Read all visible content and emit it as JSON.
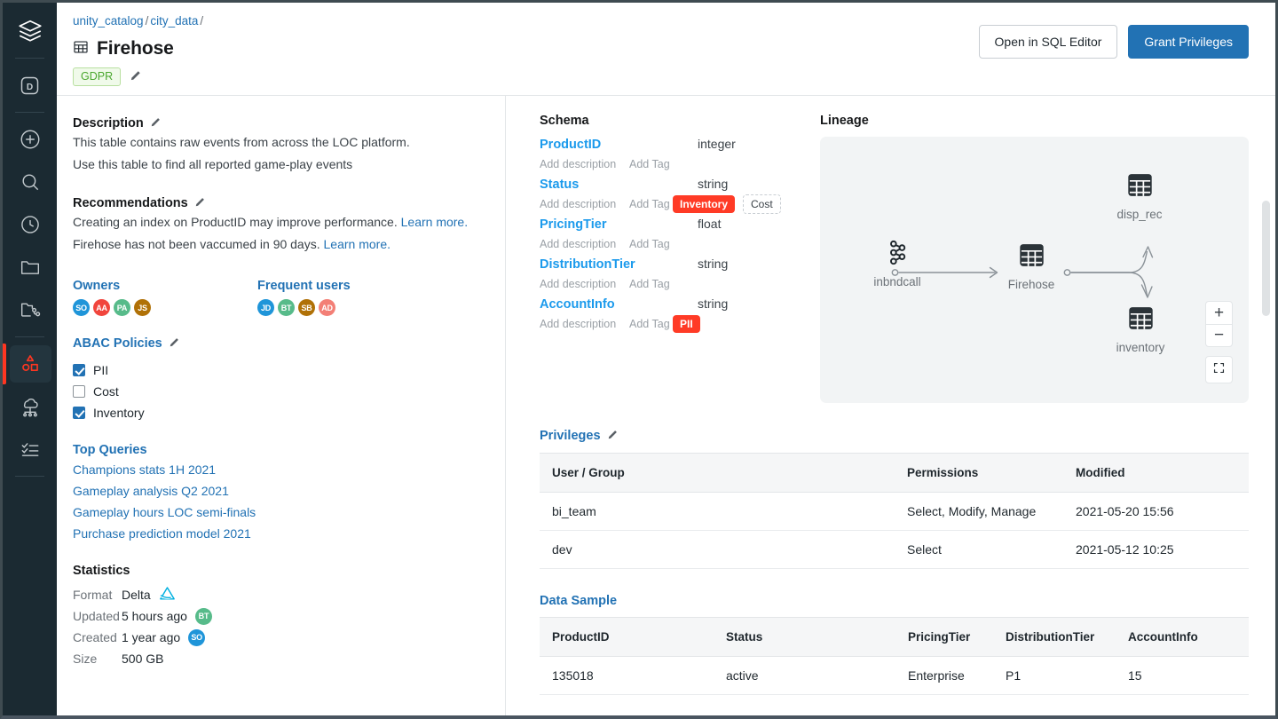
{
  "rail": {
    "items": [
      {
        "name": "logo-layers-icon",
        "label": "Databricks logo"
      },
      {
        "name": "workspace-d-icon",
        "label": "Workspace"
      },
      {
        "name": "plus-circle-icon",
        "label": "New"
      },
      {
        "name": "search-icon",
        "label": "Search"
      },
      {
        "name": "clock-icon",
        "label": "Recents"
      },
      {
        "name": "folder-icon",
        "label": "Workspace files"
      },
      {
        "name": "repos-icon",
        "label": "Repos"
      },
      {
        "name": "data-shapes-icon",
        "label": "Data"
      },
      {
        "name": "compute-icon",
        "label": "Compute"
      },
      {
        "name": "checklist-icon",
        "label": "Jobs"
      }
    ],
    "active_index": 7,
    "accent": "#ff3621",
    "background": "#1b2a32"
  },
  "header": {
    "breadcrumb": [
      {
        "label": "unity_catalog",
        "link": true
      },
      {
        "label": "city_data",
        "link": true
      }
    ],
    "breadcrumb_separator": "/",
    "breadcrumb_trailing": "/",
    "title": "Firehose",
    "title_icon": "table-icon",
    "tag": "GDPR",
    "tag_edit_icon": "pencil-icon",
    "buttons": {
      "secondary": "Open in SQL Editor",
      "primary": "Grant Privileges"
    }
  },
  "left": {
    "description": {
      "heading": "Description",
      "edit_icon": "pencil-icon",
      "lines": [
        "This table contains raw events from across the LOC platform.",
        "Use this table to find all reported game-play events"
      ]
    },
    "recommendations": {
      "heading": "Recommendations",
      "edit_icon": "pencil-icon",
      "items": [
        {
          "text": "Creating an index on ProductID may improve performance.",
          "link": "Learn more."
        },
        {
          "text": "Firehose has not been vaccumed in 90 days.",
          "link": "Learn more."
        }
      ]
    },
    "owners": {
      "heading": "Owners",
      "avatars": [
        {
          "initials": "SO",
          "color": "#1f95d9"
        },
        {
          "initials": "AA",
          "color": "#f1453d"
        },
        {
          "initials": "PA",
          "color": "#57bb8a"
        },
        {
          "initials": "JS",
          "color": "#b07107"
        }
      ]
    },
    "frequent_users": {
      "heading": "Frequent users",
      "avatars": [
        {
          "initials": "JD",
          "color": "#1f95d9"
        },
        {
          "initials": "BT",
          "color": "#57bb8a"
        },
        {
          "initials": "SB",
          "color": "#b07107"
        },
        {
          "initials": "AD",
          "color": "#f37f76"
        }
      ]
    },
    "abac": {
      "heading": "ABAC Policies",
      "edit_icon": "pencil-icon",
      "items": [
        {
          "label": "PII",
          "checked": true
        },
        {
          "label": "Cost",
          "checked": false
        },
        {
          "label": "Inventory",
          "checked": true
        }
      ]
    },
    "top_queries": {
      "heading": "Top Queries",
      "items": [
        "Champions stats 1H 2021",
        "Gameplay analysis Q2 2021",
        "Gameplay hours LOC semi-finals",
        "Purchase prediction model 2021"
      ]
    },
    "statistics": {
      "heading": "Statistics",
      "rows": [
        {
          "label": "Format",
          "value": "Delta",
          "icon": "delta-logo-icon"
        },
        {
          "label": "Updated",
          "value": "5 hours ago",
          "avatar": {
            "initials": "BT",
            "color": "#57bb8a"
          }
        },
        {
          "label": "Created",
          "value": "1 year ago",
          "avatar": {
            "initials": "SO",
            "color": "#1f95d9"
          }
        },
        {
          "label": "Size",
          "value": "500 GB"
        }
      ]
    }
  },
  "schema": {
    "heading": "Schema",
    "add_description_label": "Add description",
    "add_tag_label": "Add Tag",
    "columns": [
      {
        "name": "ProductID",
        "type": "integer",
        "tags": []
      },
      {
        "name": "Status",
        "type": "string",
        "tags": [
          {
            "label": "Inventory",
            "style": "solid"
          },
          {
            "label": "Cost",
            "style": "ghost"
          }
        ]
      },
      {
        "name": "PricingTier",
        "type": "float",
        "tags": []
      },
      {
        "name": "DistributionTier",
        "type": "string",
        "tags": []
      },
      {
        "name": "AccountInfo",
        "type": "string",
        "tags": [
          {
            "label": "PII",
            "style": "solid"
          }
        ]
      }
    ],
    "tag_color": "#ff3b26"
  },
  "lineage": {
    "heading": "Lineage",
    "nodes": [
      {
        "id": "inbndcall",
        "label": "inbndcall",
        "icon": "stream-icon"
      },
      {
        "id": "firehose",
        "label": "Firehose",
        "icon": "table-icon"
      },
      {
        "id": "disp_rec",
        "label": "disp_rec",
        "icon": "table-icon"
      },
      {
        "id": "inventory",
        "label": "inventory",
        "icon": "table-icon"
      }
    ],
    "edges": [
      {
        "from": "inbndcall",
        "to": "firehose"
      },
      {
        "from": "firehose",
        "to": "disp_rec"
      },
      {
        "from": "firehose",
        "to": "inventory"
      }
    ],
    "controls": {
      "zoom_in": "+",
      "zoom_out": "−",
      "fullscreen_icon": "fullscreen-icon"
    }
  },
  "privileges": {
    "heading": "Privileges",
    "edit_icon": "pencil-icon",
    "headers": [
      "User / Group",
      "Permissions",
      "Modified"
    ],
    "rows": [
      [
        "bi_team",
        "Select, Modify, Manage",
        "2021-05-20 15:56"
      ],
      [
        "dev",
        "Select",
        "2021-05-12 10:25"
      ]
    ]
  },
  "data_sample": {
    "heading": "Data Sample",
    "headers": [
      "ProductID",
      "Status",
      "PricingTier",
      "DistributionTier",
      "AccountInfo"
    ],
    "rows": [
      [
        "135018",
        "active",
        "Enterprise",
        "P1",
        "15"
      ]
    ]
  }
}
